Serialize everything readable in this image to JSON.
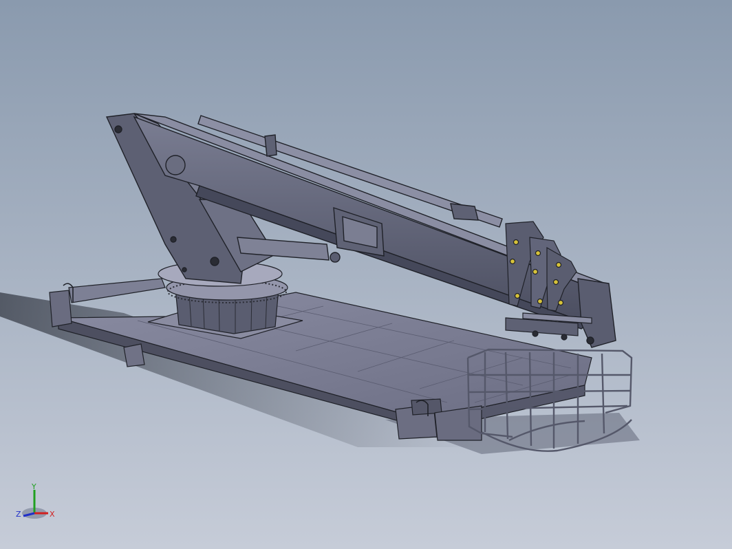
{
  "viewport": {
    "background_top": "#8a9aae",
    "background_bottom": "#c6ccd8"
  },
  "model": {
    "body_color": "#5e6174",
    "edge_color": "#1f2128",
    "highlight_color": "#8d90a6",
    "deck_color": "#7d7f94"
  },
  "triad": {
    "x_label": "X",
    "y_label": "Y",
    "z_label": "Z",
    "x_color": "#d22020",
    "y_color": "#20a020",
    "z_color": "#2030c8"
  }
}
